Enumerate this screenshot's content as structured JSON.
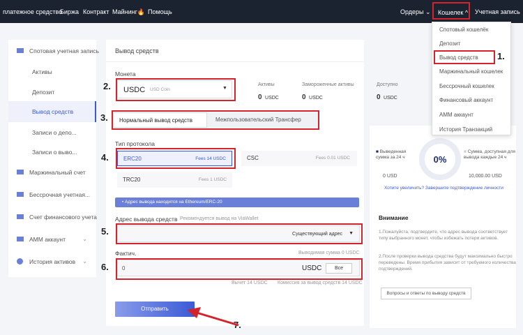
{
  "nav": {
    "payment": "платежное средство",
    "exchange": "Биржа",
    "contract": "Контракт",
    "mining": "Майнинг",
    "help": "Помощь",
    "orders": "Ордеры",
    "wallet": "Кошелек",
    "account": "Учетная запись"
  },
  "dropdown": [
    "Спотовый кошелёк",
    "Депозит",
    "Вывод средств",
    "Маржинальный кошелек",
    "Бессрочный кошелек",
    "Финансовый аккаунт",
    "AMM аккаунт",
    "История Транзакций"
  ],
  "sidebar": {
    "spot": "Спотовая учетная запись",
    "assets": "Активы",
    "deposit": "Депозит",
    "withdraw": "Вывод средств",
    "dep_records": "Записи о депо...",
    "wd_records": "Записи о выво...",
    "margin": "Маржинальный счет",
    "perpetual": "Бессрочная учетная...",
    "financial": "Счет финансового учета",
    "amm": "AMM аккаунт",
    "history": "История активов"
  },
  "main": {
    "title": "Вывод средств",
    "coin_label": "Монета",
    "coin": "USDC",
    "coin_name": "USD Coin",
    "assets_label": "Активы",
    "assets_val": "0",
    "frozen_label": "Замороженные активы",
    "frozen_val": "0",
    "avail_label": "Доступно",
    "avail_val": "0",
    "unit": "USDC",
    "tab_normal": "Нормальный вывод средств",
    "tab_internal": "Межпользовательский Трансфер",
    "proto_label": "Тип протокола",
    "erc": "ERC20",
    "erc_fee": "Fees 14 USDC",
    "csc": "CSC",
    "csc_fee": "Fees 0.01 USDC",
    "trc": "TRC20",
    "trc_fee": "Fees 1 USDC",
    "notice": "• Адрес вывода находится на Ethereum/ERC-20",
    "addr_label": "Адрес вывода средств",
    "addr_hint": "Рекомендуется вывод на ViaWallet",
    "addr_select": "Существующий адрес",
    "actual_label": "Фактич.",
    "withdrawable": "Выводимая сумма 0 USDC",
    "amount": "0",
    "all_btn": "Все",
    "fee_received": "Вычет 14 USDC",
    "fee_commission": "Комиссия за вывод средств 14 USDC",
    "submit": "Отправить"
  },
  "right": {
    "percent": "0%",
    "withdrawn_label": "Выведенная сумма за 24 ч",
    "withdrawn_val": "0 USD",
    "avail24_label": "Сумма, доступная для вывода каждые 24 ч",
    "avail24_val": "10,000.00 USD",
    "upgrade": "Хотите увеличить? Завершите подтверждение личности",
    "attention": "Внимание",
    "note1": "1.Пожалуйста, подтвердите, что адрес вывода соответствует типу выбранного монет, чтобы избежать потери активов.",
    "note2": "2.После проверки вывода средства будут максимально быстро переведены. Время прибытия зависит от требуемого количества подтверждений.",
    "faq": "Вопросы и ответы по выводу средств"
  },
  "steps": [
    "1.",
    "2.",
    "3.",
    "4.",
    "5.",
    "6.",
    "7."
  ]
}
